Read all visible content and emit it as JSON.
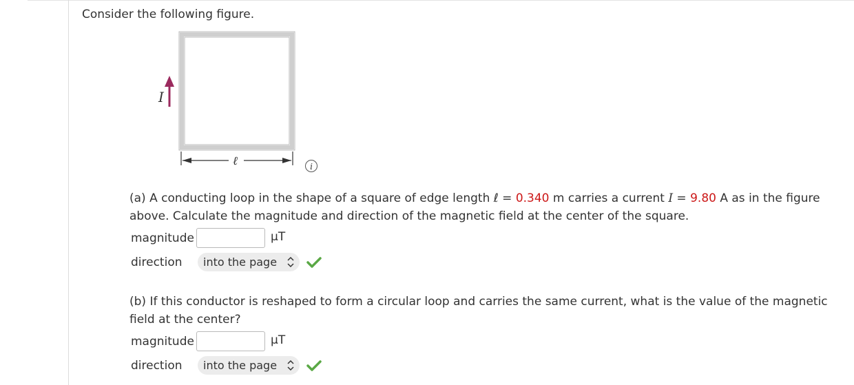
{
  "intro": "Consider the following figure.",
  "figure": {
    "current_symbol": "I",
    "length_symbol": "ℓ",
    "info_glyph": "i"
  },
  "part_a": {
    "line1_pre": "(a) A conducting loop in the shape of a square of edge length ℓ = ",
    "length_value": "0.340",
    "line1_mid": " m carries a current ",
    "current_symbol": "I",
    "eq": " = ",
    "current_value": "9.80",
    "line1_post": " A as in the figure",
    "line2": "above. Calculate the magnitude and direction of the magnetic field at the center of the square.",
    "magnitude_label": "magnitude",
    "unit": "μT",
    "direction_label": "direction",
    "direction_value": "into the page"
  },
  "part_b": {
    "line1": "(b) If this conductor is reshaped to form a circular loop and carries the same current, what is the value of the magnetic",
    "line2": "field at the center?",
    "magnitude_label": "magnitude",
    "unit": "μT",
    "direction_label": "direction",
    "direction_value": "into the page"
  },
  "colors": {
    "given_value": "#cc1818",
    "arrow": "#9b2a5e",
    "check": "#5aa845"
  },
  "icons": {
    "info": "info-icon",
    "chevron": "chevron-updown-icon",
    "check": "checkmark-icon"
  }
}
